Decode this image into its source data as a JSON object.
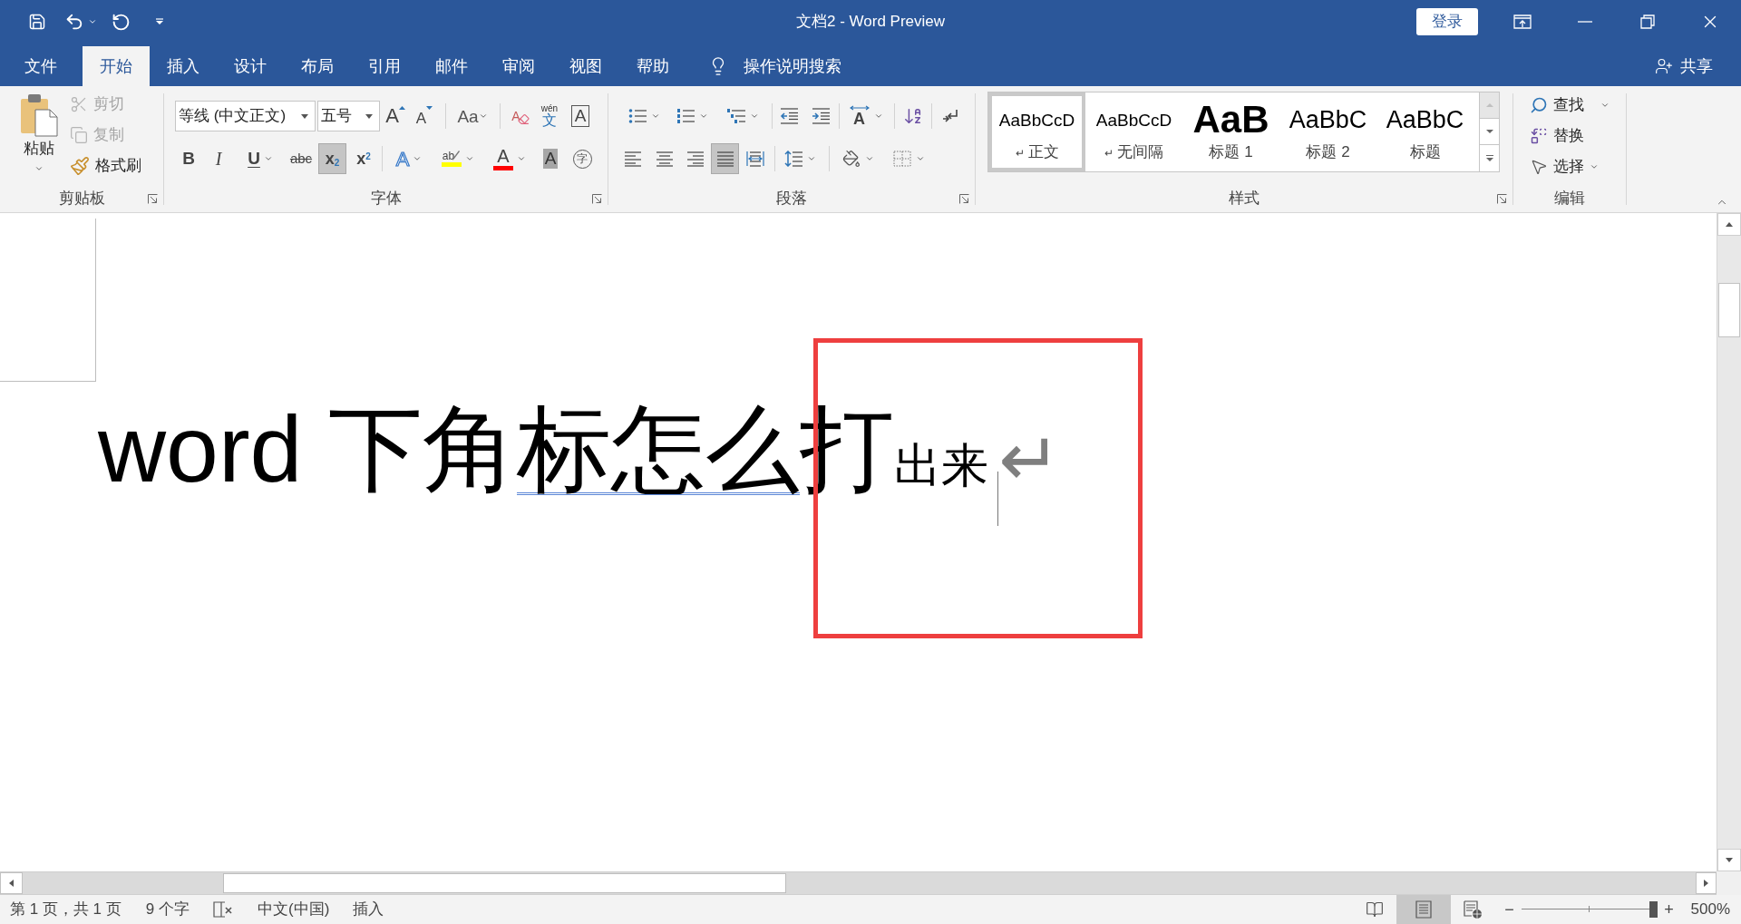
{
  "window": {
    "title": "文档2 - Word Preview",
    "sign_in": "登录"
  },
  "tabs": [
    {
      "label": "文件",
      "selected": false
    },
    {
      "label": "开始",
      "selected": true
    },
    {
      "label": "插入",
      "selected": false
    },
    {
      "label": "设计",
      "selected": false
    },
    {
      "label": "布局",
      "selected": false
    },
    {
      "label": "引用",
      "selected": false
    },
    {
      "label": "邮件",
      "selected": false
    },
    {
      "label": "审阅",
      "selected": false
    },
    {
      "label": "视图",
      "selected": false
    },
    {
      "label": "帮助",
      "selected": false
    }
  ],
  "tell_me": {
    "label": "操作说明搜索"
  },
  "share": {
    "label": "共享"
  },
  "clipboard": {
    "label": "剪贴板",
    "paste": "粘贴",
    "items": [
      {
        "kind": "cut",
        "label": "剪切",
        "disabled": true
      },
      {
        "kind": "copy",
        "label": "复制",
        "disabled": true
      },
      {
        "kind": "format_painter",
        "label": "格式刷",
        "disabled": false
      }
    ]
  },
  "font": {
    "label": "字体",
    "font_name": "等线 (中文正文)",
    "font_size": "五号",
    "row_1": [
      {
        "kind": "grow",
        "glyph": "A"
      },
      {
        "kind": "shrink",
        "glyph": "A"
      },
      {
        "kind": "change_case",
        "glyph": "Aa"
      },
      {
        "kind": "clear_formatting",
        "glyph": "A"
      },
      {
        "kind": "phonetic_guide",
        "glyph": "wén",
        "glyph_2": "文"
      },
      {
        "kind": "character_border",
        "glyph": "A"
      }
    ],
    "row_2": [
      {
        "kind": "bold",
        "glyph": "B",
        "on": false
      },
      {
        "kind": "italic",
        "glyph": "I",
        "on": false
      },
      {
        "kind": "underline",
        "glyph": "U",
        "on": false
      },
      {
        "kind": "strikethrough",
        "glyph": "abc",
        "on": false
      },
      {
        "kind": "subscript",
        "glyph": "x$_{2}$",
        "on": true
      },
      {
        "kind": "superscript",
        "glyph": "x$^{2}$",
        "on": false
      },
      {
        "kind": "text_effects",
        "glyph": "A",
        "on": false
      },
      {
        "kind": "highlight",
        "glyph": "ab",
        "color": "#ffff00",
        "on": false
      },
      {
        "kind": "font_color",
        "glyph": "A",
        "color": "#ff0000",
        "on": false
      },
      {
        "kind": "character_shading",
        "glyph": "A",
        "on": false
      },
      {
        "kind": "enclose_characters",
        "glyph": "字",
        "on": false
      }
    ]
  },
  "paragraph": {
    "label": "段落",
    "row_1": [
      {
        "kind": "bullets"
      },
      {
        "kind": "numbering"
      },
      {
        "kind": "multilevel"
      },
      {
        "kind": "decrease_indent"
      },
      {
        "kind": "increase_indent"
      },
      {
        "kind": "text_direction",
        "glyph": "A"
      },
      {
        "kind": "sort"
      },
      {
        "kind": "show_marks"
      }
    ],
    "alignment": [
      {
        "kind": "left",
        "selected": false
      },
      {
        "kind": "center",
        "selected": false
      },
      {
        "kind": "right",
        "selected": false
      },
      {
        "kind": "justify",
        "selected": true
      },
      {
        "kind": "distributed",
        "selected": false
      }
    ],
    "row_2": [
      {
        "kind": "line_spacing"
      },
      {
        "kind": "shading"
      },
      {
        "kind": "borders"
      }
    ]
  },
  "styles": {
    "label": "样式",
    "gallery": [
      {
        "kind": "normal",
        "preview": "AaBbCcD",
        "mark": "↵",
        "label": "正文",
        "selected": true
      },
      {
        "kind": "normal",
        "preview": "AaBbCcD",
        "mark": "↵",
        "label": "无间隔",
        "selected": false
      },
      {
        "kind": "heading_1",
        "preview": "AaB",
        "label": "标题 1",
        "selected": false
      },
      {
        "kind": "heading_2",
        "preview": "AaBbC",
        "label": "标题 2",
        "selected": false
      },
      {
        "kind": "title",
        "preview": "AaBbC",
        "label": "标题",
        "selected": false
      }
    ]
  },
  "editing": {
    "label": "编辑",
    "items": [
      {
        "kind": "find",
        "label": "查找"
      },
      {
        "kind": "replace",
        "label": "替换"
      },
      {
        "kind": "select",
        "label": "选择"
      }
    ]
  },
  "document": {
    "runs": [
      {
        "text": "word 下角",
        "kind": "normal",
        "flagged": false
      },
      {
        "text": "标怎么",
        "kind": "normal",
        "flagged": true
      },
      {
        "text": "打",
        "kind": "normal",
        "flagged": false
      },
      {
        "text": "出来",
        "kind": "subscript",
        "flagged": false
      }
    ],
    "paragraph_mark": "↵"
  },
  "status_bar": {
    "page": "第 1 页，共 1 页",
    "words": "9 个字",
    "language": "中文(中国)",
    "mode": "插入",
    "views": [
      {
        "kind": "read",
        "selected": false
      },
      {
        "kind": "print",
        "selected": true
      },
      {
        "kind": "web",
        "selected": false
      }
    ],
    "zoom_out": "−",
    "zoom_in": "+",
    "zoom": {
      "level": 1
    },
    "zoom_percent": "500%"
  }
}
